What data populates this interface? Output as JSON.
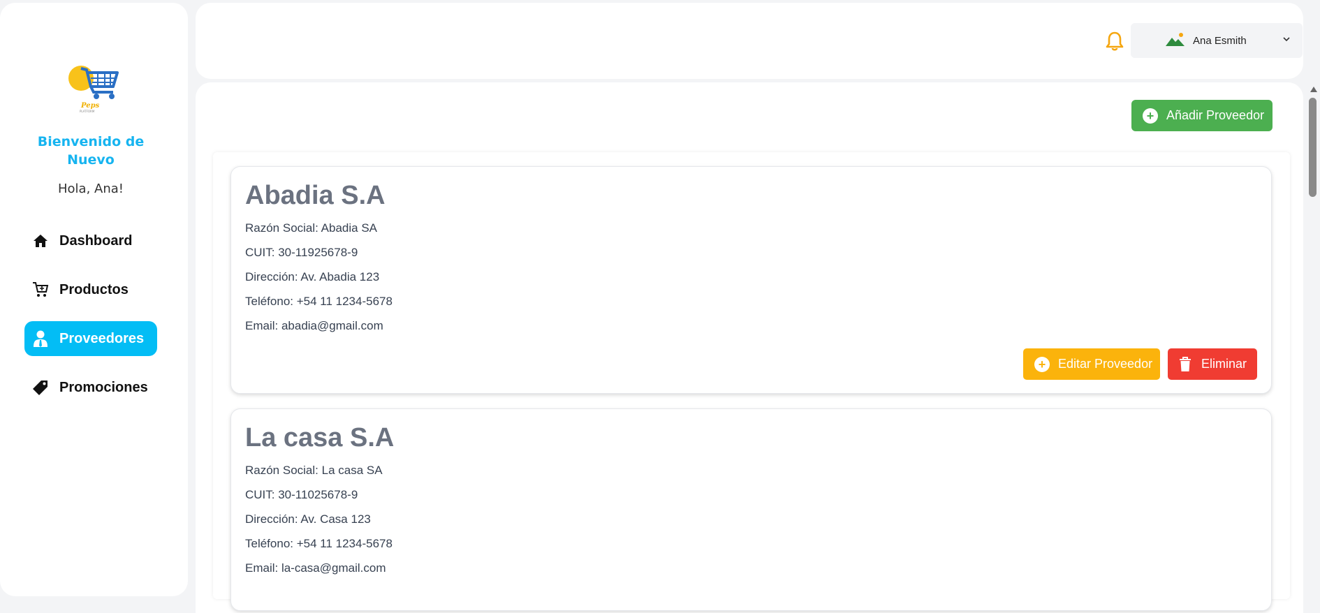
{
  "sidebar": {
    "logo_alt": "Peps",
    "welcome": "Bienvenido de Nuevo",
    "hello": "Hola, Ana!",
    "items": [
      {
        "label": "Dashboard",
        "icon": "home-icon"
      },
      {
        "label": "Productos",
        "icon": "cart-icon"
      },
      {
        "label": "Proveedores",
        "icon": "user-icon",
        "active": true
      },
      {
        "label": "Promociones",
        "icon": "tag-icon"
      }
    ]
  },
  "header": {
    "user_name": "Ana Esmith"
  },
  "main": {
    "add_button": "Añadir Proveedor",
    "edit_button": "Editar Proveedor",
    "delete_button": "Eliminar",
    "providers": [
      {
        "name": "Abadia S.A",
        "razon_social": "Razón Social: Abadia SA",
        "cuit": "CUIT: 30-11925678-9",
        "direccion": "Dirección: Av. Abadia 123",
        "telefono": "Teléfono: +54 11 1234-5678",
        "email": "Email: abadia@gmail.com"
      },
      {
        "name": "La casa S.A",
        "razon_social": "Razón Social: La casa SA",
        "cuit": "CUIT: 30-11025678-9",
        "direccion": "Dirección: Av. Casa 123",
        "telefono": "Teléfono: +54 11 1234-5678",
        "email": "Email: la-casa@gmail.com"
      }
    ]
  },
  "colors": {
    "accent": "#03bdf5",
    "add": "#4caf50",
    "edit": "#fbb30c",
    "delete": "#f03c32",
    "bell": "#f5a60f"
  }
}
